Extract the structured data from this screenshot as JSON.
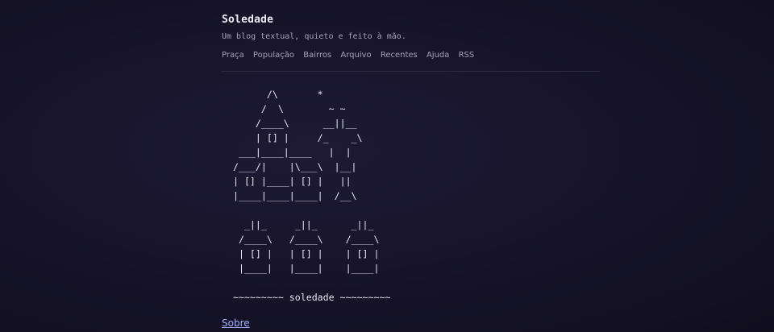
{
  "site": {
    "title": "Soledade",
    "tagline": "Um blog textual, quieto e feito à mão."
  },
  "nav": [
    {
      "label": "Praça"
    },
    {
      "label": "População"
    },
    {
      "label": "Bairros"
    },
    {
      "label": "Arquivo"
    },
    {
      "label": "Recentes"
    },
    {
      "label": "Ajuda"
    },
    {
      "label": "RSS"
    }
  ],
  "ascii_art": "       /\\       *\n      /  \\        ~ ~\n     /____\\      __||__\n     | [] |     /_    _\\\n  ___|____|____   |  |\n /___/|    |\\___\\  |__|\n | [] |____| [] |   ||\n |____|____|____|  /__\\\n\n   _||_     _||_      _||_\n  /____\\   /____\\    /____\\\n  | [] |   | [] |    | [] |\n  |____|   |____|    |____|\n\n ~~~~~~~~~ soledade ~~~~~~~~~",
  "footer": {
    "about_label": "Sobre"
  },
  "colors": {
    "background": "#161329",
    "text": "#e6e6ee",
    "muted": "#a4a4b4",
    "link": "#9fb0ff",
    "divider": "#2d2a45"
  }
}
